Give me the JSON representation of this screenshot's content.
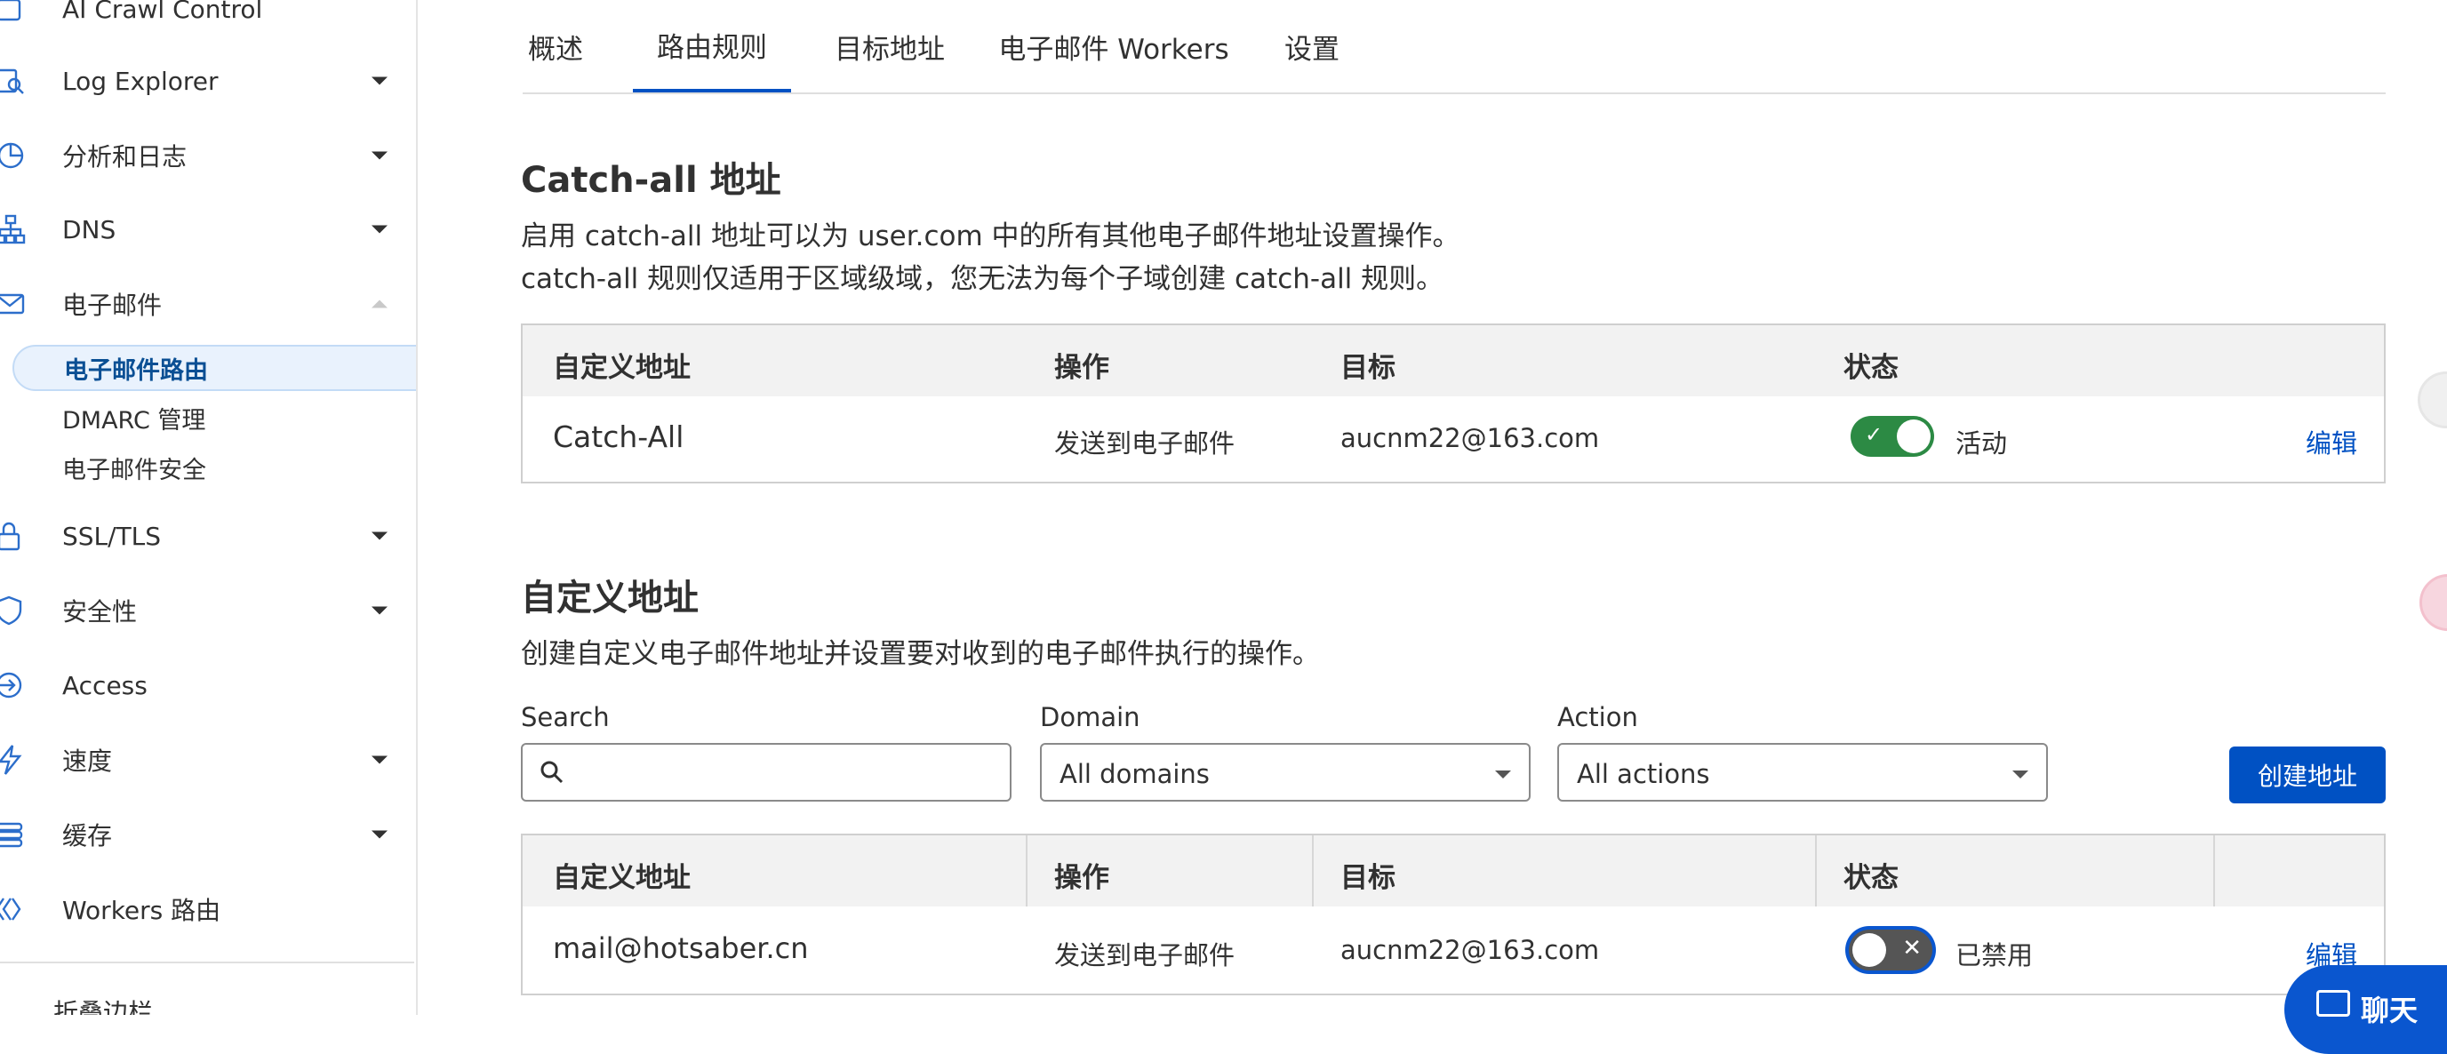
{
  "sidebar": {
    "items": [
      {
        "label": "AI Crawl Control",
        "icon": "robot-icon"
      },
      {
        "label": "Log Explorer",
        "icon": "log-icon"
      },
      {
        "label": "分析和日志",
        "icon": "chart-pie-icon"
      },
      {
        "label": "DNS",
        "icon": "network-icon"
      },
      {
        "label": "电子邮件",
        "icon": "mail-icon"
      },
      {
        "label": "SSL/TLS",
        "icon": "lock-icon"
      },
      {
        "label": "安全性",
        "icon": "shield-icon"
      },
      {
        "label": "Access",
        "icon": "access-icon"
      },
      {
        "label": "速度",
        "icon": "bolt-icon"
      },
      {
        "label": "缓存",
        "icon": "stack-icon"
      },
      {
        "label": "Workers 路由",
        "icon": "workers-icon"
      }
    ],
    "email_subitems": [
      "电子邮件路由",
      "DMARC 管理",
      "电子邮件安全"
    ],
    "collapse_label": "折叠边栏"
  },
  "tabs": [
    "概述",
    "路由规则",
    "目标地址",
    "电子邮件 Workers",
    "设置"
  ],
  "active_tab": "路由规则",
  "catch_all": {
    "title": "Catch-all 地址",
    "desc_line1": "启用 catch-all 地址可以为 user.com 中的所有其他电子邮件地址设置操作。",
    "desc_line2": "catch-all 规则仅适用于区域级域，您无法为每个子域创建 catch-all 规则。",
    "headers": [
      "自定义地址",
      "操作",
      "目标",
      "状态"
    ],
    "row": {
      "address": "Catch-All",
      "action": "发送到电子邮件",
      "target": "aucnm22@163.com",
      "status": "活动",
      "enabled": true,
      "edit": "编辑"
    }
  },
  "custom": {
    "title": "自定义地址",
    "desc": "创建自定义电子邮件地址并设置要对收到的电子邮件执行的操作。",
    "filters": {
      "search_label": "Search",
      "search_value": "",
      "domain_label": "Domain",
      "domain_value": "All domains",
      "action_label": "Action",
      "action_value": "All actions"
    },
    "create_button": "创建地址",
    "headers": [
      "自定义地址",
      "操作",
      "目标",
      "状态"
    ],
    "rows": [
      {
        "address": "mail@hotsaber.cn",
        "action": "发送到电子邮件",
        "target": "aucnm22@163.com",
        "status": "已禁用",
        "enabled": false,
        "edit": "编辑"
      }
    ]
  },
  "chat": {
    "label": "聊天"
  },
  "colors": {
    "accent": "#0051c3",
    "toggle_on": "#2c8a44",
    "toggle_off": "#555555"
  }
}
